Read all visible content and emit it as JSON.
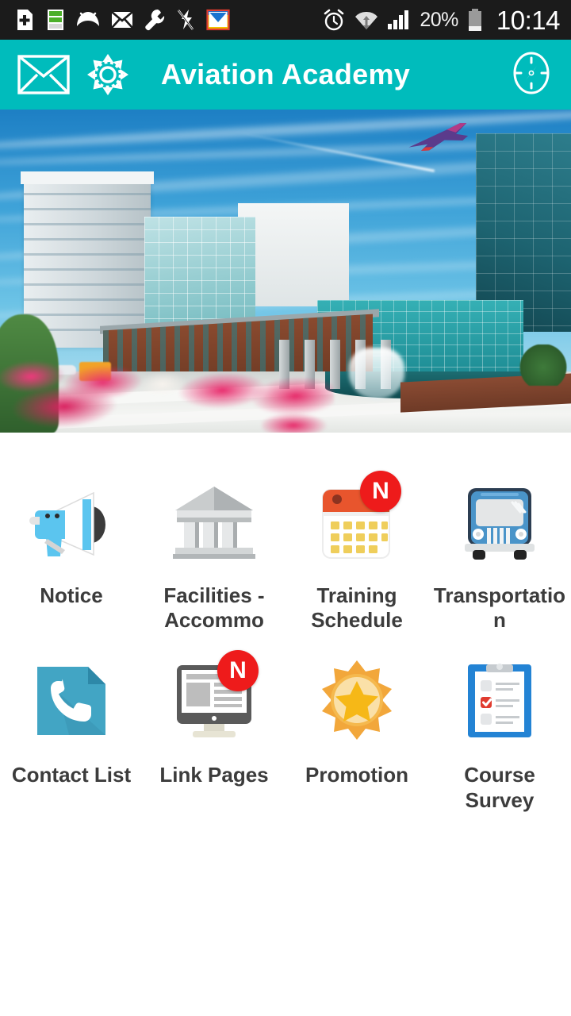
{
  "statusbar": {
    "time": "10:14",
    "battery_percent": "20%",
    "left_icons": [
      "sd-card-add-icon",
      "battery-level-icon",
      "sad-face-icon",
      "mail-closed-icon",
      "wrench-icon",
      "flash-off-icon",
      "inbox-download-icon"
    ],
    "right_icons": [
      "alarm-clock-icon",
      "wifi-icon",
      "cellular-signal-icon",
      "battery-icon"
    ]
  },
  "appbar": {
    "title": "Aviation Academy",
    "background_color": "#00bcbc",
    "mail_icon": "envelope-icon",
    "settings_icon": "gear-icon",
    "explore_icon": "compass-icon"
  },
  "hero": {
    "alt": "Aviation Academy campus with modern glass buildings, fountain plaza, pink flower beds and an airplane flying overhead"
  },
  "menu": {
    "badge_label": "N",
    "badge_color": "#ee1b1b",
    "label_color": "#3c3c3c",
    "rows": [
      [
        {
          "label": "Notice",
          "icon": "megaphone-icon",
          "badge": false
        },
        {
          "label": "Facilities - Accommo",
          "icon": "bank-building-icon",
          "badge": false
        },
        {
          "label": "Training Schedule",
          "icon": "calendar-icon",
          "badge": true
        },
        {
          "label": "Transportation",
          "icon": "bus-icon",
          "badge": false
        }
      ],
      [
        {
          "label": "Contact List",
          "icon": "phone-contact-icon",
          "badge": false
        },
        {
          "label": "Link Pages",
          "icon": "monitor-webpage-icon",
          "badge": true
        },
        {
          "label": "Promotion",
          "icon": "star-badge-icon",
          "badge": false
        },
        {
          "label": "Course Survey",
          "icon": "clipboard-checklist-icon",
          "badge": false
        }
      ]
    ]
  }
}
